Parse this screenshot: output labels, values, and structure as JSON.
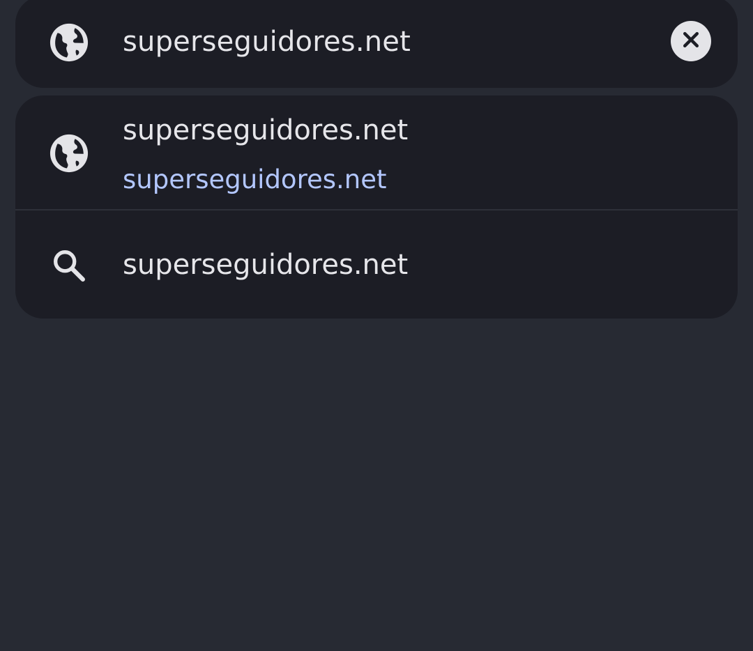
{
  "omnibox": {
    "value": "superseguidores.net",
    "leading_icon": "globe-icon",
    "clear_icon": "close-icon"
  },
  "suggestions": [
    {
      "title": "superseguidores.net",
      "url": "superseguidores.net",
      "icon": "globe-icon"
    },
    {
      "title": "superseguidores.net",
      "icon": "search-icon"
    }
  ],
  "colors": {
    "background": "#272a33",
    "surface": "#1c1d25",
    "text": "#e6e6ea",
    "url_accent": "#b3c7ff",
    "icon": "#e4e4e8"
  }
}
